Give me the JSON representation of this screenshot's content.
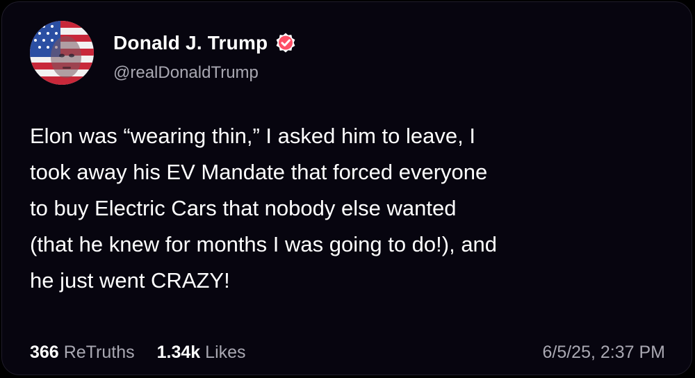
{
  "post": {
    "author": {
      "display_name": "Donald J. Trump",
      "handle": "@realDonaldTrump",
      "verified_icon": "verified-badge-icon",
      "badge_color": "#ff4f66"
    },
    "text_lines": [
      "Elon was “wearing thin,” I asked him to leave, I",
      "took away his EV Mandate that forced everyone",
      "to buy Electric Cars that nobody else wanted",
      "(that he knew for months I was going to do!), and",
      "he just went CRAZY!"
    ],
    "retruths": {
      "count": "366",
      "label": "ReTruths"
    },
    "likes": {
      "count": "1.34k",
      "label": "Likes"
    },
    "timestamp": "6/5/25, 2:37 PM"
  },
  "colors": {
    "background": "#07050f",
    "text": "#ffffff",
    "muted": "#a9a8b2"
  }
}
